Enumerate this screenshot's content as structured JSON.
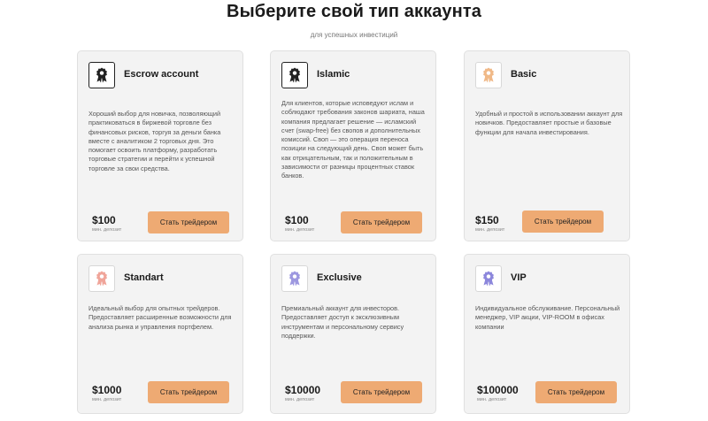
{
  "header": {
    "title": "Выберите свой тип аккаунта",
    "subtitle": "для успешных инвестиций"
  },
  "price_label": "мин. депозит",
  "button_label": "Стать трейдером",
  "accent_color": "#eeaa73",
  "cards": [
    {
      "title": "Escrow account",
      "icon": "award-ribbon-icon",
      "icon_color": "#222222",
      "description": "Хороший выбор для новичка, позволяющий практиковаться в биржевой торговле без финансовых рисков, торгуя за деньги банка вместе с аналитиком 2 торговых дня. Это помогает освоить платформу, разработать торговые стратегии и перейти к успешной торговле за свои средства.",
      "price": "$100"
    },
    {
      "title": "Islamic",
      "icon": "award-ribbon-icon",
      "icon_color": "#222222",
      "description": "Для клиентов, которые исповедуют ислам и соблюдают требования законов шариата, наша компания предлагает решение — исламский счет (swap-free) без свопов и дополнительных комиссий. Своп — это операция переноса позиции на следующий день. Своп может быть как отрицательным, так и положительным в зависимости от разницы процентных ставок банков.",
      "price": "$100"
    },
    {
      "title": "Basic",
      "icon": "award-ribbon-icon",
      "icon_color": "#f0b988",
      "description": "Удобный и простой в использовании аккаунт для новичков. Предоставляет простые и базовые функции для начала инвестирования.",
      "price": "$150"
    },
    {
      "title": "Standart",
      "icon": "award-ribbon-icon",
      "icon_color": "#f0a59a",
      "description": "Идеальный выбор для опытных трейдеров. Предоставляет расширенные возможности для анализа рынка и управления портфелем.",
      "price": "$1000"
    },
    {
      "title": "Exclusive",
      "icon": "award-ribbon-icon",
      "icon_color": "#9d98e0",
      "description": "Премиальный аккаунт для инвесторов. Предоставляет доступ к эксклюзивным инструментам и персональному сервису поддержки.",
      "price": "$10000"
    },
    {
      "title": "VIP",
      "icon": "award-ribbon-icon",
      "icon_color": "#8c87dc",
      "description": "Индивидуальное обслуживание. Персональный менеджер, VIP акции, VIP-ROOM в офисах компании",
      "price": "$100000"
    }
  ]
}
